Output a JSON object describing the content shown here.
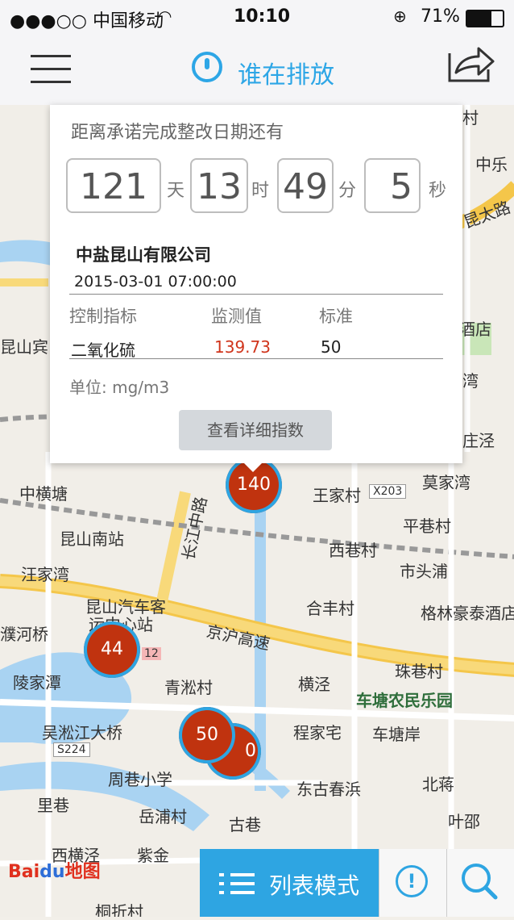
{
  "status_bar": {
    "carrier": "●●●○○ 中国移动",
    "time": "10:10",
    "battery": "71%"
  },
  "header": {
    "title": "谁在排放"
  },
  "popup": {
    "heading": "距离承诺完成整改日期还有",
    "countdown": [
      {
        "value": "121",
        "unit": "天"
      },
      {
        "value": "13",
        "unit": "时"
      },
      {
        "value": "49",
        "unit": "分"
      },
      {
        "value": "5",
        "unit": "秒"
      }
    ],
    "company": "中盐昆山有限公司",
    "datetime": "2015-03-01 07:00:00",
    "table_headers": [
      "控制指标",
      "监测值",
      "标准"
    ],
    "row": {
      "indicator": "二氧化硫",
      "value": "139.73",
      "standard": "50"
    },
    "unit_label": "单位: mg/m3",
    "detail_button": "查看详细指数"
  },
  "markers": [
    {
      "label": "140"
    },
    {
      "label": "44"
    },
    {
      "label": "50"
    },
    {
      "label": "0"
    }
  ],
  "map_labels": [
    "中横塘",
    "昆山南站",
    "汪家湾",
    "昆山汽车客",
    "运中心站",
    "濮河桥",
    "陵家潭",
    "吴淞江大桥",
    "S224",
    "周巷小学",
    "里巷",
    "岳浦村",
    "西横泾",
    "紫金",
    "古巷",
    "青淞村",
    "程家宅",
    "车塘岸",
    "东古春浜",
    "北蒋",
    "叶邵",
    "王家村",
    "X203",
    "莫家湾",
    "平巷村",
    "西巷村",
    "市头浦",
    "合丰村",
    "格林豪泰酒店",
    "横泾",
    "珠巷村",
    "车塘农民乐园",
    "京沪高速",
    "长江中路",
    "中乐",
    "昆山宾",
    "酒店",
    "湾",
    "庄泾",
    "昆太路",
    "村",
    "12",
    "桐折村"
  ],
  "bottom_bar": {
    "list_mode": "列表模式"
  },
  "colors": {
    "accent": "#2ea5e2",
    "marker": "#c0330f",
    "value_red": "#d0351c"
  }
}
